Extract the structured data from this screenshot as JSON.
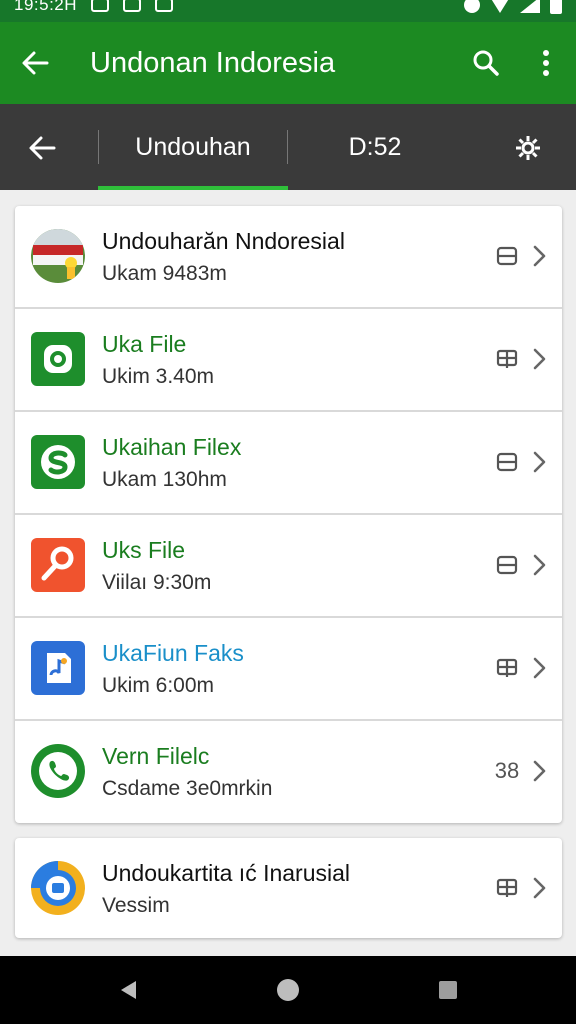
{
  "status_bar": {
    "time": "19:5:2H"
  },
  "app_bar": {
    "title": "Undonan Indoresia"
  },
  "tabs": {
    "active_label": "Undouhan",
    "time_label": "D:52"
  },
  "colors": {
    "app_bar": "#1c8a22",
    "status_bar": "#17772a",
    "tab_bar": "#3a3a3a",
    "tab_indicator": "#2fbf3a",
    "green_text": "#1a7d1f",
    "blue_text": "#1a8fc9"
  },
  "list": [
    {
      "name": "Undouharăn Nndoresial",
      "sub": "Ukam 9483m",
      "icon": "flag-photo-icon",
      "action_icon": "storage-icon",
      "name_color": "#111111"
    },
    {
      "name": "Uka File",
      "sub": "Ukim 3.40m",
      "icon": "green-app-icon",
      "action_icon": "grid-icon",
      "name_color": "#1a7d1f"
    },
    {
      "name": "Ukaihan Filex",
      "sub": "Ukam 130hm",
      "icon": "green-s-icon",
      "action_icon": "storage-icon",
      "name_color": "#1a7d1f"
    },
    {
      "name": "Uks File",
      "sub": "Viilaı 9:30m",
      "icon": "orange-key-icon",
      "action_icon": "storage-icon",
      "name_color": "#1a7d1f"
    },
    {
      "name": "UkaFiun Faks",
      "sub": "Ukim 6:00m",
      "icon": "blue-note-icon",
      "action_icon": "grid-icon",
      "name_color": "#1a8fc9"
    },
    {
      "name": "Vern Filelc",
      "sub": "Csdame 3e0mrkin",
      "icon": "phone-icon",
      "action_text": "38",
      "name_color": "#1a7d1f"
    }
  ],
  "list2": [
    {
      "name": "Undoukartita ıć Inarusial",
      "sub": "Vessim",
      "icon": "chrome-like-icon",
      "action_icon": "grid-icon",
      "name_color": "#111111"
    }
  ]
}
